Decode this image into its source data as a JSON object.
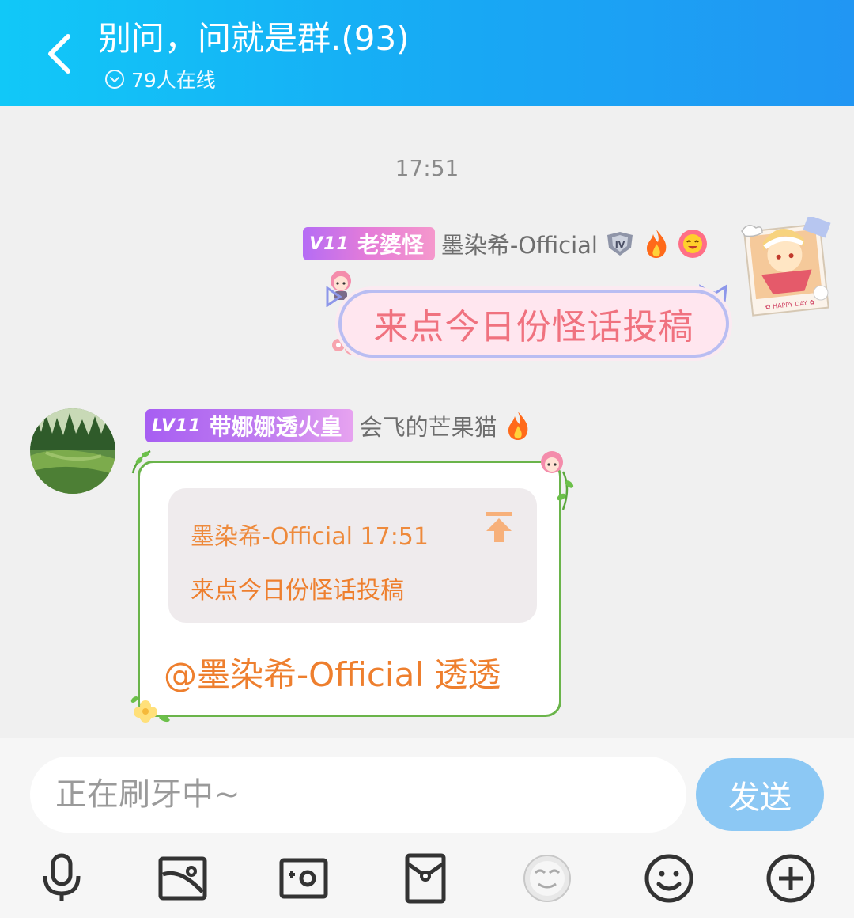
{
  "header": {
    "title": "别问，问就是群.(93)",
    "online": "79人在线"
  },
  "chat": {
    "timestamp": "17:51",
    "messages": [
      {
        "side": "right",
        "badge_level": "V11",
        "badge_title": "老婆怪",
        "nickname": "墨染希-Official",
        "text": "来点今日份怪话投稿"
      },
      {
        "side": "left",
        "badge_level": "LV11",
        "badge_title": "带娜娜透火皇",
        "nickname": "会飞的芒果猫",
        "quote_header": "墨染希-Official 17:51",
        "quote_text": "来点今日份怪话投稿",
        "text": "@墨染希-Official 透透"
      }
    ]
  },
  "input": {
    "placeholder": "正在刷牙中~",
    "send_label": "发送"
  },
  "toolbar": {
    "icons": [
      "microphone-icon",
      "image-icon",
      "camera-icon",
      "red-packet-icon",
      "sticker-face-icon",
      "emoji-icon",
      "plus-icon"
    ]
  },
  "colors": {
    "header_start": "#11c8f8",
    "header_end": "#2196f3",
    "send_button": "#8cc8f4",
    "reply_text": "#ee7f2e",
    "bubble_right_text": "#f0727f",
    "bubble_left_border": "#6ab44a"
  }
}
